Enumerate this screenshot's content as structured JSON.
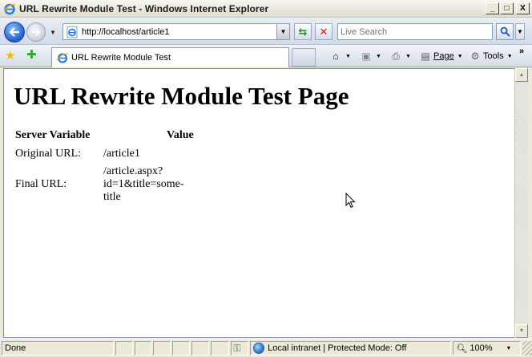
{
  "window": {
    "title": "URL Rewrite Module Test - Windows Internet Explorer",
    "controls": {
      "minimize": "_",
      "maximize": "□",
      "close": "X"
    }
  },
  "address_bar": {
    "url": "http://localhost/article1"
  },
  "search": {
    "placeholder": "Live Search"
  },
  "tabs": [
    {
      "label": "URL Rewrite Module Test"
    }
  ],
  "command_bar": {
    "page_label": "Page",
    "tools_label": "Tools",
    "overflow": "»"
  },
  "page": {
    "title": "URL Rewrite Module Test Page",
    "table": {
      "headers": [
        "Server Variable",
        "Value"
      ],
      "rows": [
        [
          "Original URL:",
          "/article1"
        ],
        [
          "Final URL:",
          "/article.aspx?id=1&title=some-title"
        ]
      ]
    }
  },
  "status_bar": {
    "status": "Done",
    "zone": "Local intranet | Protected Mode: Off",
    "zoom": "100%"
  },
  "colors": {
    "accent": "#1f5cc8",
    "content_bg": "#ffffff",
    "chrome_bg": "#ece9d8"
  }
}
